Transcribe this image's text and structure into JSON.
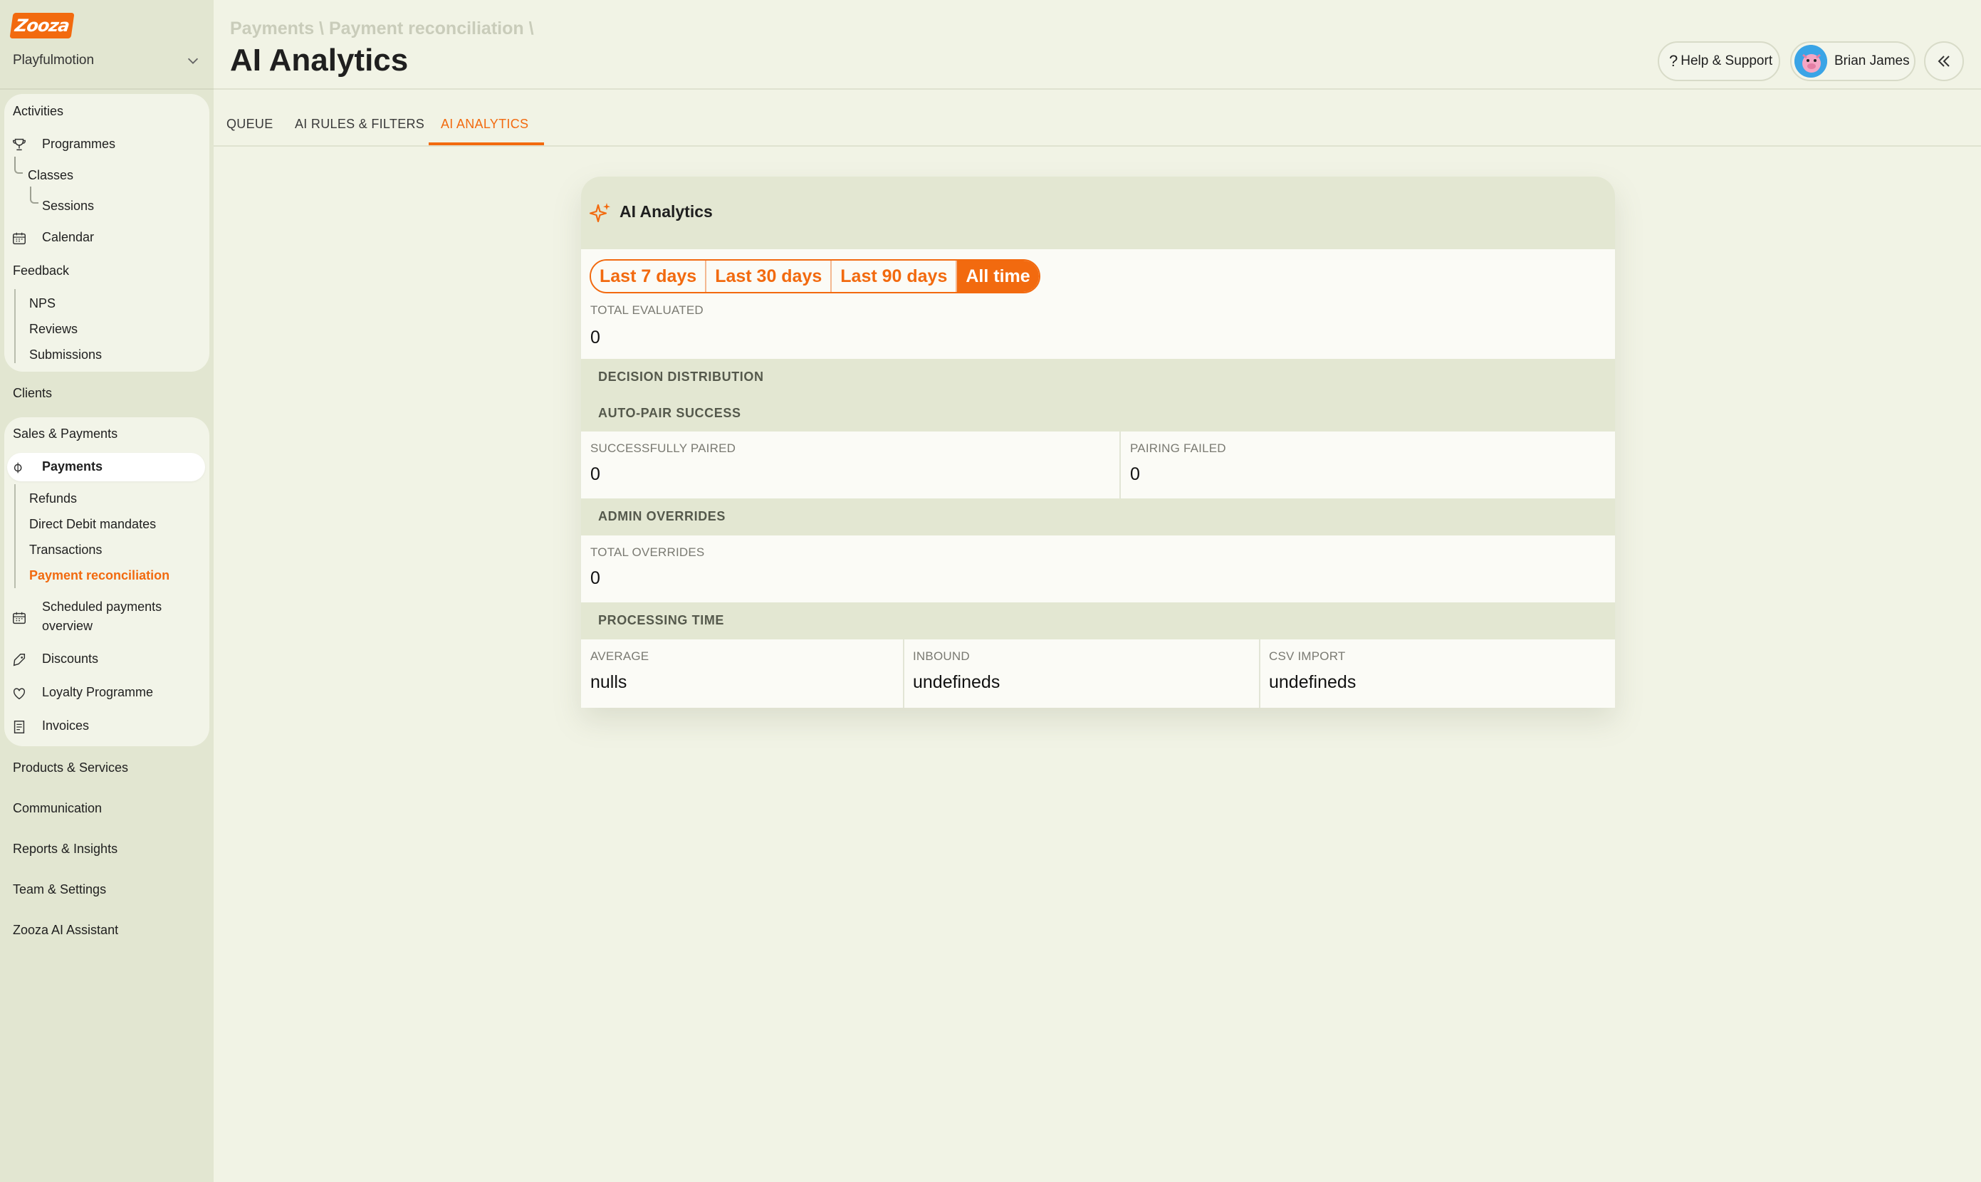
{
  "brand": {
    "logo_text": "Zooza",
    "org_name": "Playfulmotion"
  },
  "sidebar": {
    "activities": {
      "label": "Activities",
      "programmes": "Programmes",
      "classes": "Classes",
      "sessions": "Sessions",
      "calendar": "Calendar"
    },
    "feedback": {
      "label": "Feedback",
      "nps": "NPS",
      "reviews": "Reviews",
      "submissions": "Submissions"
    },
    "clients": "Clients",
    "sales": {
      "label": "Sales & Payments",
      "payments": "Payments",
      "refunds": "Refunds",
      "direct_debit": "Direct Debit mandates",
      "transactions": "Transactions",
      "payment_reconciliation": "Payment reconciliation",
      "scheduled_line1": "Scheduled payments",
      "scheduled_line2": "overview",
      "discounts": "Discounts",
      "loyalty": "Loyalty Programme",
      "invoices": "Invoices"
    },
    "products": "Products & Services",
    "communication": "Communication",
    "reports": "Reports & Insights",
    "team": "Team & Settings",
    "ai_assistant": "Zooza AI Assistant"
  },
  "header": {
    "breadcrumb": "Payments \\ Payment reconciliation \\",
    "title": "AI Analytics",
    "help": "Help & Support",
    "user_name": "Brian James"
  },
  "tabs": [
    {
      "label": "QUEUE",
      "active": false
    },
    {
      "label": "AI RULES & FILTERS",
      "active": false
    },
    {
      "label": "AI ANALYTICS",
      "active": true
    }
  ],
  "card": {
    "title": "AI Analytics",
    "periods": [
      "Last 7 days",
      "Last 30 days",
      "Last 90 days",
      "All time"
    ],
    "selected_period": "All time",
    "total_evaluated": {
      "label": "TOTAL EVALUATED",
      "value": "0"
    },
    "decision_distribution": "DECISION DISTRIBUTION",
    "auto_pair": {
      "title": "AUTO-PAIR SUCCESS",
      "paired_label": "SUCCESSFULLY PAIRED",
      "paired_value": "0",
      "failed_label": "PAIRING FAILED",
      "failed_value": "0"
    },
    "overrides": {
      "title": "ADMIN OVERRIDES",
      "label": "TOTAL OVERRIDES",
      "value": "0"
    },
    "processing": {
      "title": "PROCESSING TIME",
      "average_label": "AVERAGE",
      "average_value": "nulls",
      "inbound_label": "INBOUND",
      "inbound_value": "undefineds",
      "csv_label": "CSV IMPORT",
      "csv_value": "undefineds"
    }
  },
  "colors": {
    "accent": "#f26a0f",
    "sidebar_bg": "#e2e6d1",
    "page_bg": "#f1f3e5",
    "card_band": "#e3e7d2"
  }
}
